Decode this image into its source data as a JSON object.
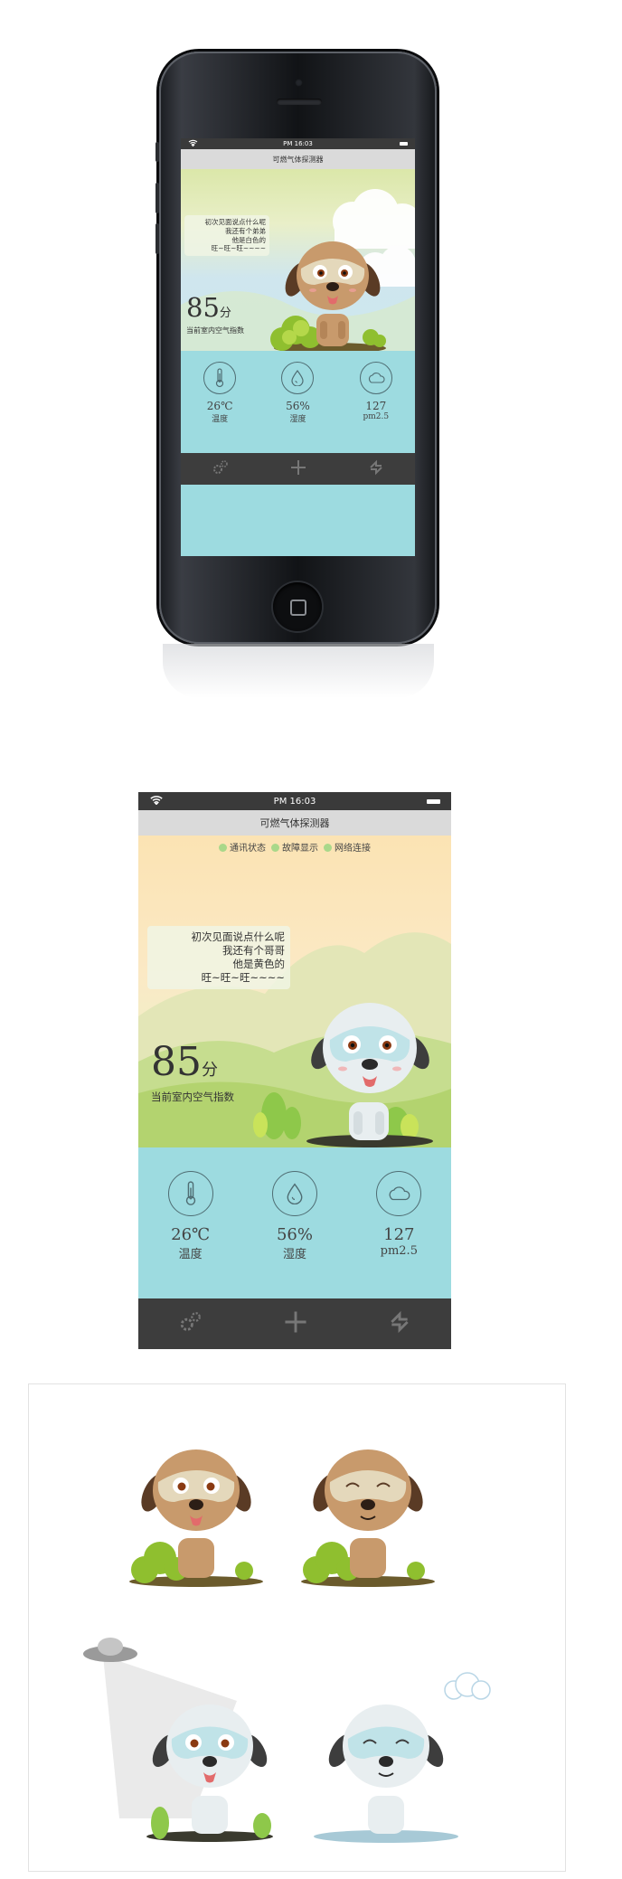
{
  "app": {
    "status_time": "PM 16:03",
    "title": "可燃气体探测器",
    "tabbar": {
      "settings_icon": "gear-icon",
      "add_icon": "plus-icon",
      "refresh_icon": "refresh-icon"
    }
  },
  "phone_screen": {
    "bubble_lines": [
      "初次见面说点什么呢",
      "我还有个弟弟",
      "他是白色的",
      "旺~旺~旺~~~~"
    ],
    "score": "85",
    "score_unit": "分",
    "score_label": "当前室内空气指数",
    "metrics": [
      {
        "icon": "thermometer-icon",
        "value": "26℃",
        "label": "温度"
      },
      {
        "icon": "droplet-icon",
        "value": "56%",
        "label": "湿度"
      },
      {
        "icon": "pm-icon",
        "value": "127",
        "label": "pm2.5"
      }
    ]
  },
  "large_screen": {
    "indicators": [
      "通讯状态",
      "故障显示",
      "网络连接"
    ],
    "indicator_color": "#a9d88a",
    "bubble_lines": [
      "初次见面说点什么呢",
      "我还有个哥哥",
      "他是黄色的",
      "旺~旺~旺~~~~"
    ],
    "score": "85",
    "score_unit": "分",
    "score_label": "当前室内空气指数",
    "metrics": [
      {
        "icon": "thermometer-icon",
        "value": "26℃",
        "label": "温度"
      },
      {
        "icon": "droplet-icon",
        "value": "56%",
        "label": "湿度"
      },
      {
        "icon": "pm-icon",
        "value": "127",
        "label": "pm2.5"
      }
    ]
  },
  "colors": {
    "sky_blue": "#c9e9f4",
    "cream": "#fbe7b9",
    "hill_green": "#b7d38f",
    "teal": "#9ddbe0",
    "tabbar": "#3d3d3d",
    "dog_brown": "#c89a6c",
    "dog_white": "#e8eef0"
  }
}
